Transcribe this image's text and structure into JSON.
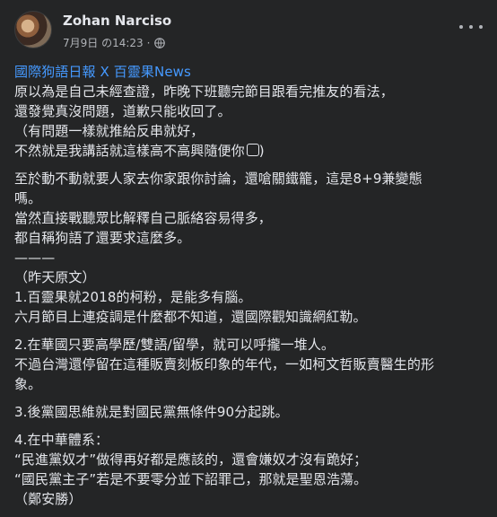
{
  "post": {
    "author": "Zohan Narciso",
    "timestamp": "7月9日 の14:23",
    "visibility_separator": "·",
    "lines": [
      "國際狗語日報 X 百靈果News",
      "原以為是自己未經查證，昨晚下班聽完節目跟看完推友的看法，",
      "還發覺真沒問題，道歉只能收回了。",
      "（有問題一樣就推給反串就好，",
      "不然就是我講話就這樣高不高興隨便你",
      "至於動不動就要人家去你家跟你討論，還嗆關鐵籠，這是8+9兼變態",
      "嗎。",
      "當然直接戰聽眾比解釋自己脈絡容易得多，",
      "都自稱狗語了還要求這麼多。",
      "———",
      "（昨天原文）",
      "1.百靈果就2018的柯粉，是能多有腦。",
      "六月節目上連疫調是什麼都不知道，還國際觀知識網紅勒。",
      "2.在華國只要高學歷/雙語/留學，就可以呼攏一堆人。",
      "不過台灣還停留在這種販賣刻板印象的年代，一如柯文哲販賣醫生的形",
      "象。",
      "3.後黨國思維就是對國民黨無條件90分起跳。",
      "4.在中華體系：",
      "“民進黨奴才”做得再好都是應該的，還會嫌奴才沒有跪好；",
      "“國民黨主子”若是不要零分並下詔罪己，那就是聖恩浩蕩。",
      "（鄭安勝）"
    ]
  },
  "icons": {
    "globe": "globe-icon",
    "more": "more-options-icon",
    "emoji": "face-emoji-icon"
  }
}
